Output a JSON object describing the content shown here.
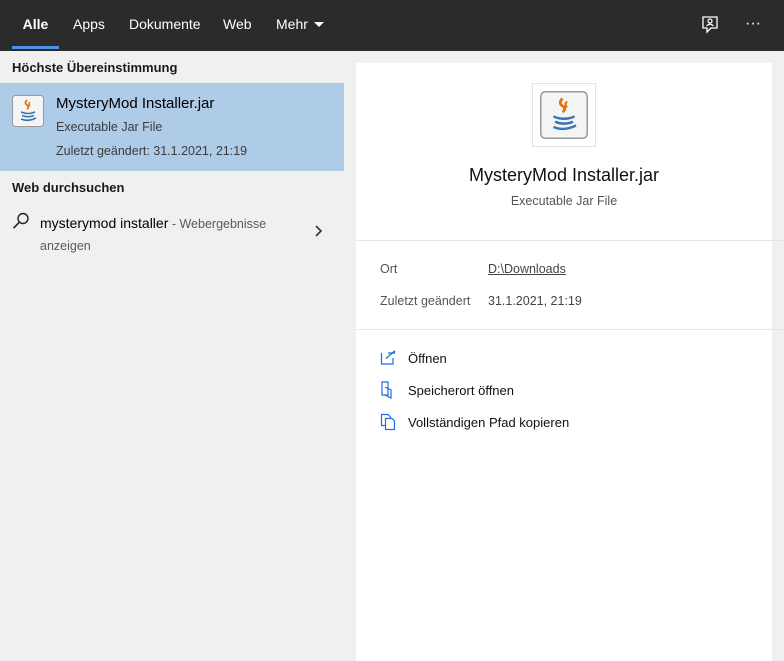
{
  "tabs": [
    {
      "label": "Alle",
      "active": true
    },
    {
      "label": "Apps",
      "active": false
    },
    {
      "label": "Dokumente",
      "active": false
    },
    {
      "label": "Web",
      "active": false
    },
    {
      "label": "Mehr",
      "active": false
    }
  ],
  "top_icons": [
    "feedback-icon",
    "more-icon"
  ],
  "more_glyph": "···",
  "left": {
    "best_match_header": "Höchste Übereinstimmung",
    "best_match": {
      "title_bold": "MysteryMod Installer",
      "title_ext": ".jar",
      "type": "Executable Jar File",
      "modified": "Zuletzt geändert: 31.1.2021, 21:19",
      "icon": "java-icon"
    },
    "web_header": "Web durchsuchen",
    "web_item": {
      "query": "mysterymod installer",
      "suffix": " - Webergebnisse anzeigen",
      "icon": "search-icon"
    }
  },
  "right": {
    "title": "MysteryMod Installer.jar",
    "subtitle": "Executable Jar File",
    "meta": [
      {
        "label": "Ort",
        "value": "D:\\Downloads",
        "link": true
      },
      {
        "label": "Zuletzt geändert",
        "value": "31.1.2021, 21:19",
        "link": false
      }
    ],
    "actions": [
      {
        "label": "Öffnen",
        "icon": "open-icon"
      },
      {
        "label": "Speicherort öffnen",
        "icon": "file-location-icon"
      },
      {
        "label": "Vollständigen Pfad kopieren",
        "icon": "copy-icon"
      }
    ]
  },
  "colors": {
    "topbar": "#2b2b2b",
    "accent": "#4f8ff0",
    "selection": "#aecbe7",
    "action_icon": "#1e6fd9"
  }
}
